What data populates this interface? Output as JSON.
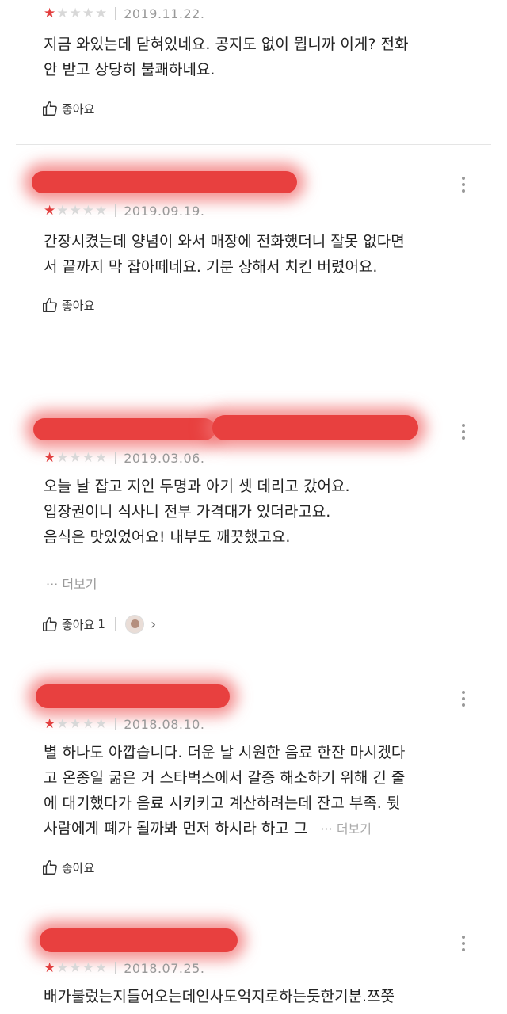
{
  "like_label": "좋아요",
  "more_label": "더보기",
  "more_prefix": "···",
  "colors": {
    "star_active": "#e23e3e",
    "star_inactive": "#d8d8d8",
    "redaction": "#e8403f",
    "divider": "#e5e5e5"
  },
  "icons": {
    "like": "thumbs-up-icon",
    "menu": "kebab-icon",
    "chevron": "chevron-right-icon"
  },
  "reviews": [
    {
      "rating": 1,
      "date": "2019.11.22.",
      "lines": [
        "지금 와있는데 닫혀있네요. 공지도 없이 뭡니까 이게? 전화",
        "안 받고 상당히 불쾌하네요."
      ],
      "likes": ""
    },
    {
      "rating": 1,
      "date": "2019.09.19.",
      "lines": [
        "간장시켰는데 양념이 와서 매장에 전화했더니 잘못 없다면",
        "서 끝까지 막 잡아떼네요. 기분 상해서 치킨 버렸어요."
      ],
      "likes": ""
    },
    {
      "rating": 1,
      "date": "2019.03.06.",
      "lines": [
        "오늘 날 잡고 지인 두명과 아기 셋 데리고 갔어요.",
        "입장권이니 식사니 전부 가격대가 있더라고요.",
        "음식은 맛있었어요! 내부도 깨끗했고요."
      ],
      "likes": "1"
    },
    {
      "rating": 1,
      "date": "2018.08.10.",
      "lines": [
        "별 하나도 아깝습니다. 더운 날 시원한 음료 한잔 마시겠다",
        "고 온종일 굶은 거 스타벅스에서 갈증 해소하기 위해 긴 줄",
        "에 대기했다가 음료 시키키고 계산하려는데 잔고 부족. 뒷",
        "사람에게 폐가 될까봐 먼저 하시라 하고 그"
      ],
      "likes": ""
    },
    {
      "rating": 1,
      "date": "2018.07.25.",
      "lines": [
        "배가불렀는지들어오는데인사도억지로하는듯한기분.쯔쯧"
      ],
      "likes": ""
    }
  ]
}
